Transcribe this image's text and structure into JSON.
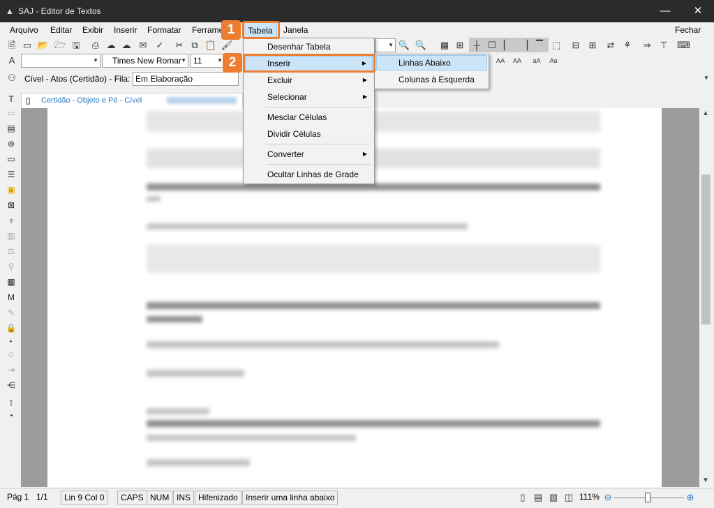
{
  "window": {
    "title": "SAJ - Editor de Textos",
    "minimize_glyph": "—",
    "close_glyph": "✕"
  },
  "menubar": {
    "items": [
      "Arquivo",
      "Editar",
      "Exibir",
      "Inserir",
      "Formatar",
      "Ferrame",
      "Tabela",
      "Janela"
    ],
    "close_label": "Fechar",
    "active_item": "Tabela"
  },
  "format": {
    "font": "Times New Romar",
    "size": "11"
  },
  "pane": {
    "label": "Cível - Atos (Certidão) - Fila:",
    "fila_value": "Em Elaboração"
  },
  "doc_tab": {
    "title": "Certidão - Objeto e Pé - Cível"
  },
  "tabela_menu": {
    "items": [
      {
        "label": "Desenhar Tabela",
        "submenu": false
      },
      {
        "label": "Inserir",
        "submenu": true
      },
      {
        "label": "Excluir",
        "submenu": true
      },
      {
        "label": "Selecionar",
        "submenu": true
      },
      {
        "label": "Mesclar Células",
        "submenu": false
      },
      {
        "label": "Dividir Células",
        "submenu": false
      },
      {
        "label": "Converter",
        "submenu": true
      },
      {
        "label": "Ocultar Linhas de Grade",
        "submenu": false
      }
    ],
    "highlighted": "Inserir"
  },
  "inserir_submenu": {
    "items": [
      "Linhas Abaixo",
      "Colunas à Esquerda"
    ],
    "highlighted": "Linhas Abaixo"
  },
  "callouts": {
    "step1": "1",
    "step2": "2",
    "color": "#ed7d31"
  },
  "statusbar": {
    "page": "Pág 1",
    "page_count": "1/1",
    "position": "Lin 9  Col 0",
    "caps": "CAPS",
    "num": "NUM",
    "ins": "INS",
    "hifenizado": "Hifenizado",
    "hint": "Inserir uma linha abaixo",
    "zoom": "111%"
  }
}
